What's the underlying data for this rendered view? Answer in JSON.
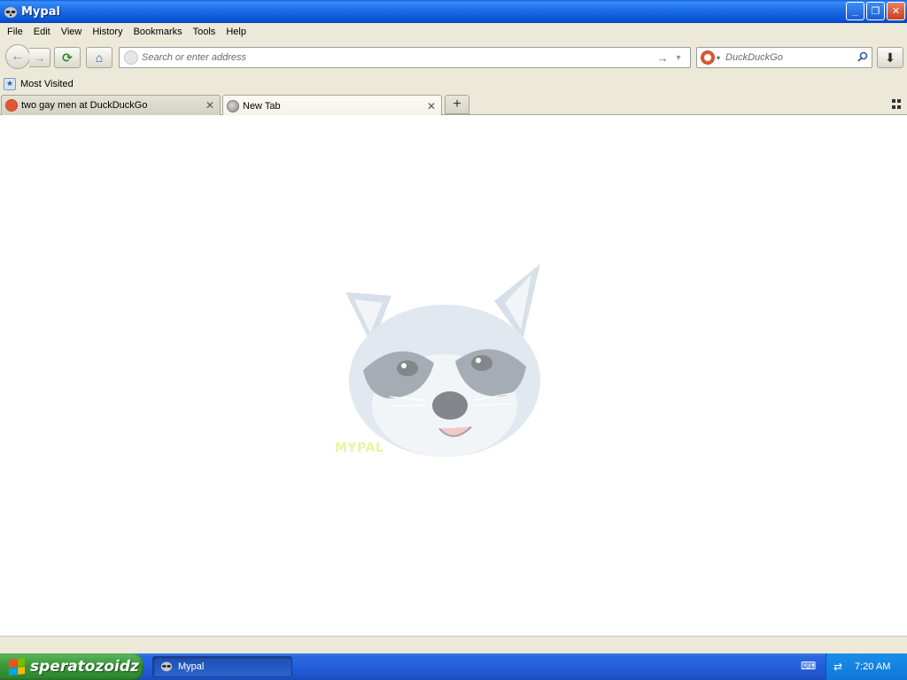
{
  "window": {
    "title": "Mypal",
    "minimize_glyph": "_",
    "restore_glyph": "❐",
    "close_glyph": "✕"
  },
  "menu": [
    {
      "label": "File"
    },
    {
      "label": "Edit"
    },
    {
      "label": "View"
    },
    {
      "label": "History"
    },
    {
      "label": "Bookmarks"
    },
    {
      "label": "Tools"
    },
    {
      "label": "Help"
    }
  ],
  "navbar": {
    "back_glyph": "←",
    "forward_glyph": "→",
    "reload_glyph": "⟳",
    "home_glyph": "⌂",
    "download_glyph": "⬇",
    "url_value": "",
    "url_placeholder": "Search or enter address",
    "go_glyph": "→",
    "dropdown_glyph": "▼",
    "search_engine": "DuckDuckGo",
    "search_value": "",
    "search_placeholder": "DuckDuckGo",
    "search_glyph": "⚲",
    "engine_caret": "▾"
  },
  "bookmarks": {
    "items": [
      {
        "label": "Most Visited",
        "icon": "most-visited-icon"
      }
    ]
  },
  "tabs": [
    {
      "label": "two gay men at DuckDuckGo",
      "icon": "duckduckgo-icon",
      "active": false,
      "close_glyph": "✕"
    },
    {
      "label": "New Tab",
      "icon": "globe-icon",
      "active": true,
      "close_glyph": "✕"
    }
  ],
  "newtab_glyph": "+",
  "content": {
    "brand_text": "MYPAL"
  },
  "taskbar": {
    "start_label": "speratozoidz",
    "task_label": "Mypal",
    "clock": "7:20 AM",
    "keyboard_glyph": "⌨",
    "network_glyph": "⇄"
  },
  "colors": {
    "titlebar": "#0a55d8",
    "chrome": "#ece9d8",
    "taskbar": "#245edb",
    "start": "#3c9a3c",
    "tray": "#0f77d6",
    "duckduckgo": "#de5833"
  }
}
